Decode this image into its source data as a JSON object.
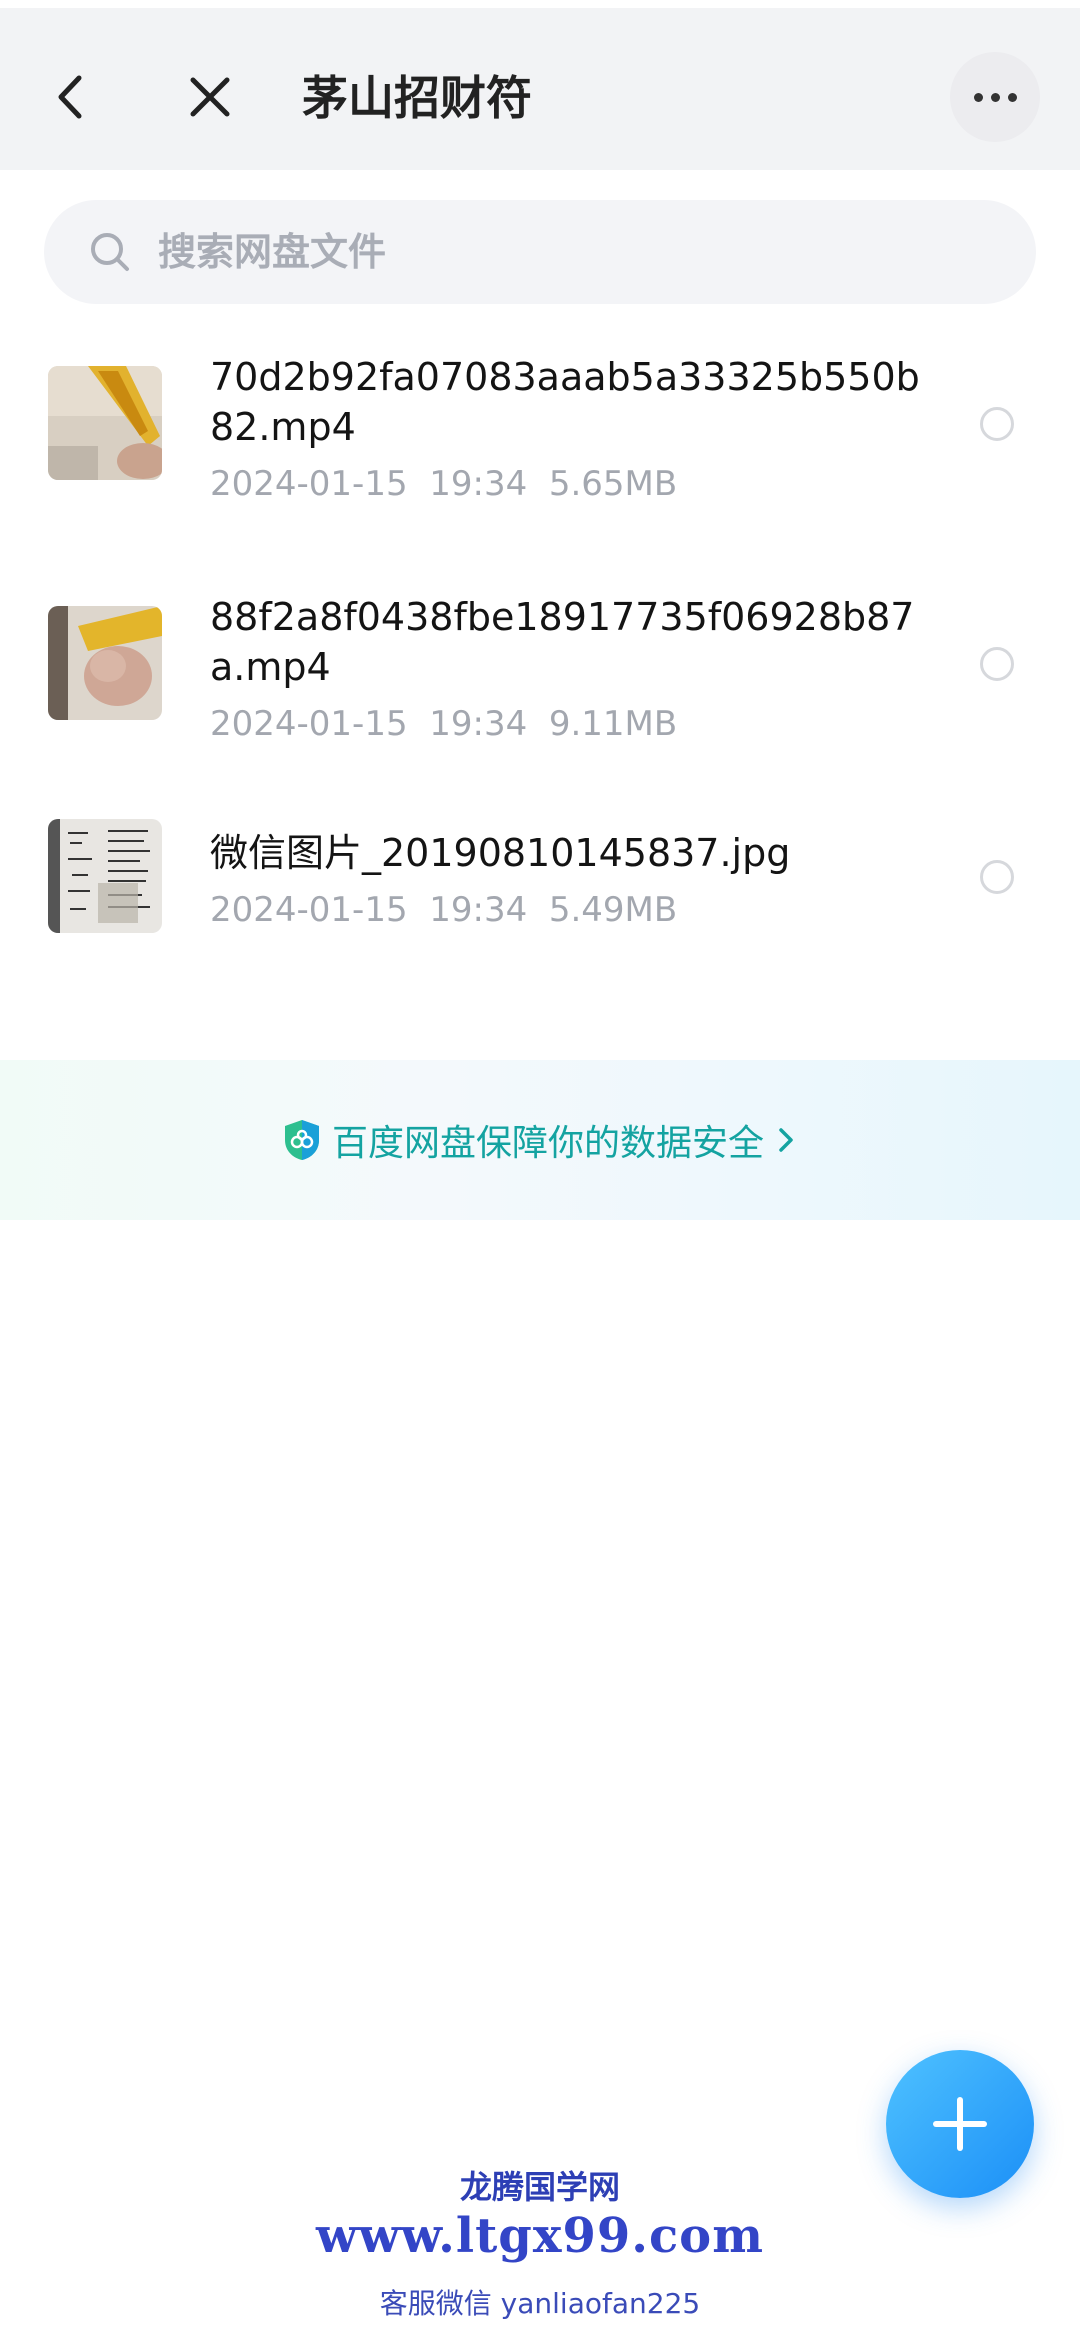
{
  "header": {
    "title": "茅山招财符",
    "back_icon": "chevron-left-icon",
    "close_icon": "close-icon",
    "more_icon": "more-horizontal-icon"
  },
  "search": {
    "placeholder": "搜索网盘文件",
    "value": ""
  },
  "files": [
    {
      "name": "70d2b92fa07083aaab5a33325b550b82.mp4",
      "date": "2024-01-15",
      "time": "19:34",
      "size": "5.65MB",
      "type": "video",
      "selected": false
    },
    {
      "name": "88f2a8f0438fbe18917735f06928b87a.mp4",
      "date": "2024-01-15",
      "time": "19:34",
      "size": "9.11MB",
      "type": "video",
      "selected": false
    },
    {
      "name": "微信图片_20190810145837.jpg",
      "date": "2024-01-15",
      "time": "19:34",
      "size": "5.49MB",
      "type": "image",
      "selected": false
    }
  ],
  "banner": {
    "text": "百度网盘保障你的数据安全",
    "icon": "shield-icon"
  },
  "fab": {
    "icon": "plus-icon"
  },
  "watermark": {
    "line1": "龙腾国学网",
    "line2": "www.ltgx99.com",
    "line3": "客服微信 yanliaofan225"
  },
  "colors": {
    "header_bg": "#f2f3f5",
    "accent": "#1b8ff7",
    "banner_text": "#14a3a1",
    "meta_text": "#a3a7af"
  }
}
